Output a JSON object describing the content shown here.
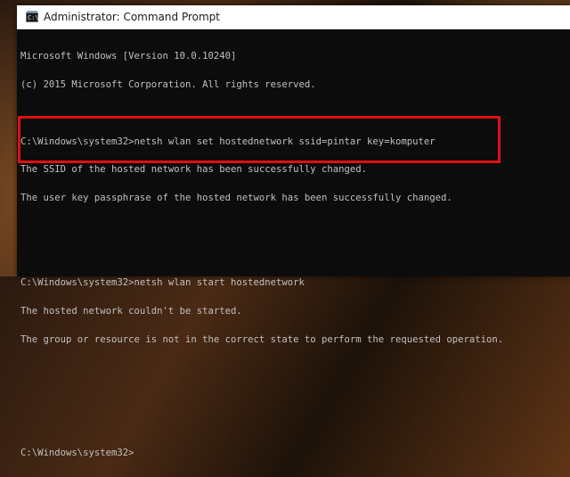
{
  "window": {
    "title": "Administrator: Command Prompt",
    "icon": "cmd-app-icon",
    "icon_glyph": "C:\\"
  },
  "console": {
    "lines": [
      "Microsoft Windows [Version 10.0.10240]",
      "(c) 2015 Microsoft Corporation. All rights reserved.",
      "",
      "C:\\Windows\\system32>netsh wlan set hostednetwork ssid=pintar key=komputer",
      "The SSID of the hosted network has been successfully changed.",
      "The user key passphrase of the hosted network has been successfully changed.",
      "",
      "",
      "C:\\Windows\\system32>netsh wlan start hostednetwork",
      "The hosted network couldn't be started.",
      "The group or resource is not in the correct state to perform the requested operation.",
      "",
      "",
      "",
      "C:\\Windows\\system32>"
    ]
  },
  "colors": {
    "console_bg": "#0c0c0c",
    "console_text": "#c0c0c0",
    "highlight_border": "#e01010"
  }
}
